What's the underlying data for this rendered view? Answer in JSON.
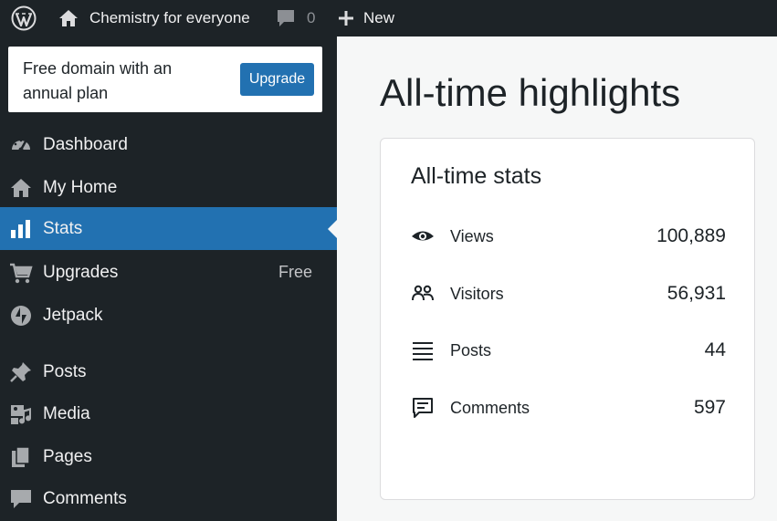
{
  "adminbar": {
    "site_name": "Chemistry for everyone",
    "comments_count": "0",
    "new_label": "New"
  },
  "promo": {
    "text": "Free domain with an annual plan",
    "button_label": "Upgrade"
  },
  "sidebar": {
    "items": [
      {
        "label": "Dashboard",
        "icon": "dashboard-icon"
      },
      {
        "label": "My Home",
        "icon": "home-icon"
      },
      {
        "label": "Stats",
        "icon": "stats-icon",
        "active": true
      },
      {
        "label": "Upgrades",
        "icon": "cart-icon",
        "badge": "Free"
      },
      {
        "label": "Jetpack",
        "icon": "jetpack-icon"
      },
      {
        "label": "Posts",
        "icon": "pin-icon"
      },
      {
        "label": "Media",
        "icon": "media-icon"
      },
      {
        "label": "Pages",
        "icon": "pages-icon"
      },
      {
        "label": "Comments",
        "icon": "comment-icon"
      }
    ]
  },
  "main": {
    "page_title": "All-time highlights",
    "card_title": "All-time stats",
    "stats": [
      {
        "label": "Views",
        "value": "100,889",
        "icon": "eye-icon"
      },
      {
        "label": "Visitors",
        "value": "56,931",
        "icon": "people-icon"
      },
      {
        "label": "Posts",
        "value": "44",
        "icon": "lines-icon"
      },
      {
        "label": "Comments",
        "value": "597",
        "icon": "comment-outline-icon"
      }
    ]
  },
  "colors": {
    "adminbar_bg": "#1d2327",
    "accent": "#2271b1",
    "text": "#1d2327"
  }
}
